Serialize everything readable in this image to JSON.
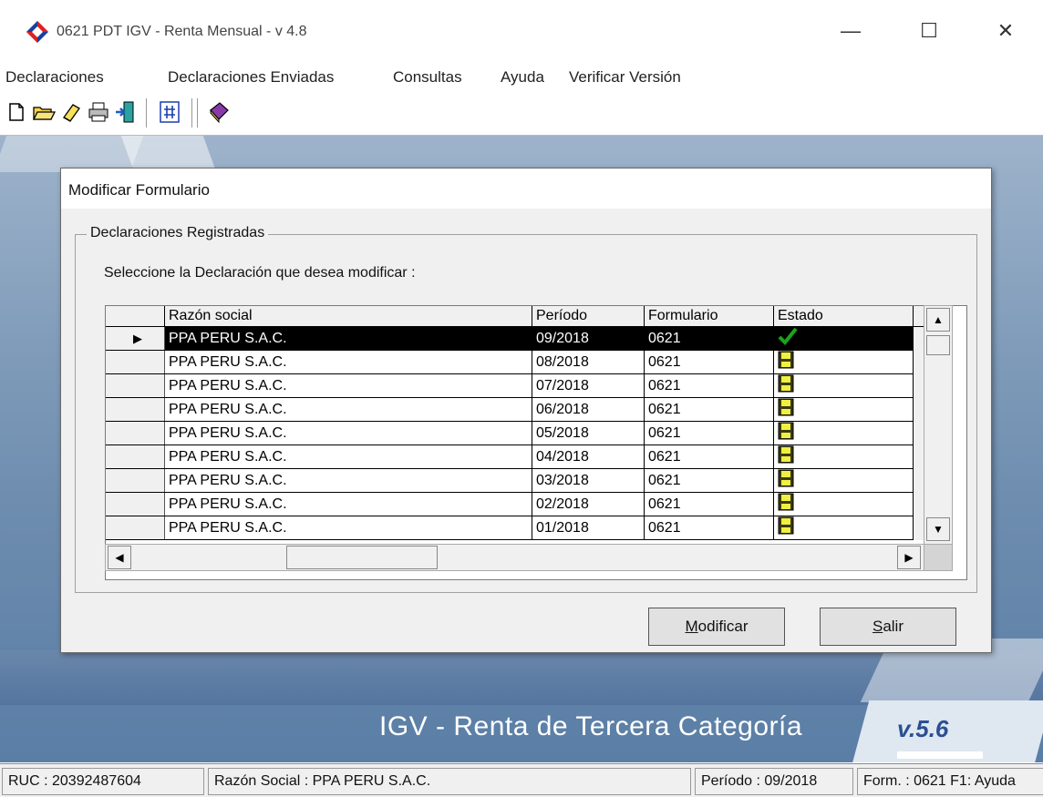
{
  "window": {
    "title": "0621 PDT IGV - Renta Mensual - v 4.8",
    "minimize": "—",
    "maximize": "☐",
    "close": "✕"
  },
  "menu": [
    "Declaraciones",
    "Declaraciones Enviadas",
    "Consultas",
    "Ayuda",
    "Verificar Versión"
  ],
  "toolbar_icons": [
    "new-file-icon",
    "open-folder-icon",
    "eraser-icon",
    "print-icon",
    "exit-door-icon",
    "calculator-icon",
    "help-book-icon"
  ],
  "dialog": {
    "title": "Modificar Formulario",
    "group_label": "Declaraciones Registradas",
    "instruction": "Seleccione la Declaración  que desea modificar :",
    "columns": [
      "Razón social",
      "Período",
      "Formulario",
      "Estado"
    ],
    "rows": [
      {
        "razon": "PPA PERU S.A.C.",
        "periodo": "09/2018",
        "formulario": "0621",
        "estado": "check-icon"
      },
      {
        "razon": "PPA PERU S.A.C.",
        "periodo": "08/2018",
        "formulario": "0621",
        "estado": "floppy-icon"
      },
      {
        "razon": "PPA PERU S.A.C.",
        "periodo": "07/2018",
        "formulario": "0621",
        "estado": "floppy-icon"
      },
      {
        "razon": "PPA PERU S.A.C.",
        "periodo": "06/2018",
        "formulario": "0621",
        "estado": "floppy-icon"
      },
      {
        "razon": "PPA PERU S.A.C.",
        "periodo": "05/2018",
        "formulario": "0621",
        "estado": "floppy-icon"
      },
      {
        "razon": "PPA PERU S.A.C.",
        "periodo": "04/2018",
        "formulario": "0621",
        "estado": "floppy-icon"
      },
      {
        "razon": "PPA PERU S.A.C.",
        "periodo": "03/2018",
        "formulario": "0621",
        "estado": "floppy-icon"
      },
      {
        "razon": "PPA PERU S.A.C.",
        "periodo": "02/2018",
        "formulario": "0621",
        "estado": "floppy-icon"
      },
      {
        "razon": "PPA PERU S.A.C.",
        "periodo": "01/2018",
        "formulario": "0621",
        "estado": "floppy-icon"
      }
    ],
    "selected_row": 0,
    "buttons": {
      "modify_hotkey": "M",
      "modify_rest": "odificar",
      "exit_hotkey": "S",
      "exit_rest": "alir"
    }
  },
  "banner": {
    "title": "IGV - Renta de Tercera Categoría",
    "version": "v.5.6"
  },
  "status": {
    "ruc": "RUC : 20392487604",
    "razon": "Razón Social : PPA PERU S.A.C.",
    "periodo": "Período : 09/2018",
    "form": "Form. : 0621  F1: Ayuda"
  },
  "colors": {
    "selected_row_bg": "#000000",
    "workspace_blue": "#7f9bb9",
    "version_blue": "#2b4f93",
    "check_green": "#1aa31a"
  }
}
